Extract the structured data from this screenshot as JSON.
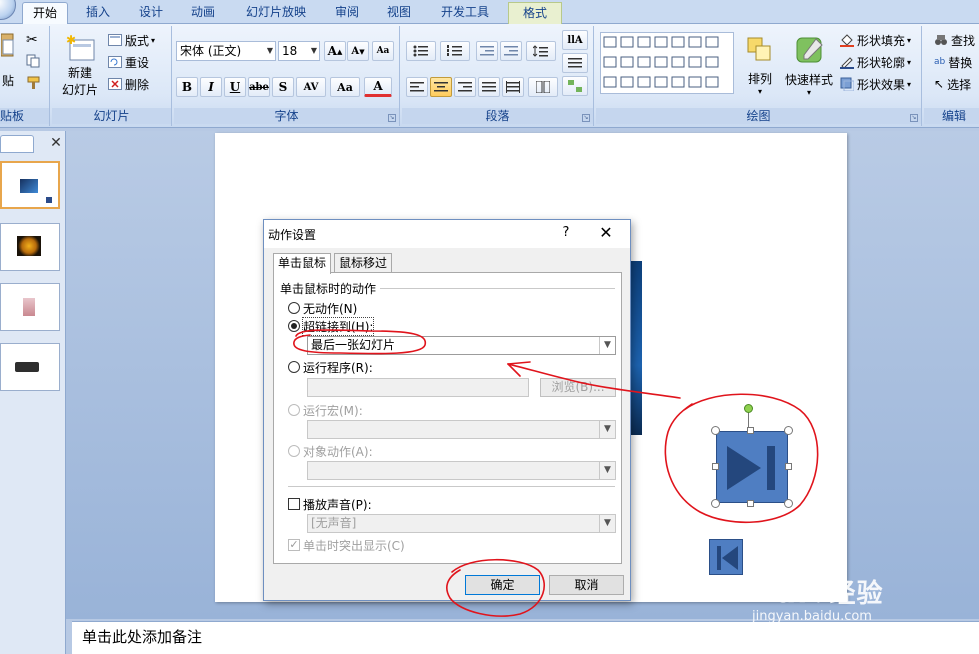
{
  "ribbon_tabs": [
    "开始",
    "插入",
    "设计",
    "动画",
    "幻灯片放映",
    "审阅",
    "视图",
    "开发工具",
    "格式"
  ],
  "clipboard": {
    "paste_label": "贴",
    "group_label": "贴板"
  },
  "slides_group": {
    "new_slide_line1": "新建",
    "new_slide_line2": "幻灯片",
    "layout_label": "版式",
    "reset_label": "重设",
    "delete_label": "删除",
    "group_label": "幻灯片"
  },
  "font_group": {
    "font_name": "宋体 (正文)",
    "font_size": "18",
    "bold": "B",
    "italic": "I",
    "underline": "U",
    "strike": "abe",
    "shadow": "S",
    "spacing": "AV",
    "case": "Aa",
    "color": "A",
    "group_label": "字体"
  },
  "paragraph_group": {
    "group_label": "段落"
  },
  "drawing_group": {
    "arrange_label": "排列",
    "quick_styles_label": "快速样式",
    "shape_fill_label": "形状填充",
    "shape_outline_label": "形状轮廓",
    "shape_effects_label": "形状效果",
    "group_label": "绘图"
  },
  "editing_group": {
    "find_label": "查找",
    "replace_label": "替换",
    "select_label": "选择",
    "group_label": "编辑"
  },
  "notes_placeholder": "单击此处添加备注",
  "dialog": {
    "title": "动作设置",
    "help": "?",
    "close": "✕",
    "tabs": [
      "单击鼠标",
      "鼠标移过"
    ],
    "section_title": "单击鼠标时的动作",
    "options": {
      "none": "无动作(N)",
      "hyperlink": "超链接到(H):",
      "hyperlink_value": "最后一张幻灯片",
      "run_program": "运行程序(R):",
      "browse": "浏览(B)...",
      "run_macro": "运行宏(M):",
      "object_action": "对象动作(A):",
      "play_sound": "播放声音(P):",
      "sound_value": "[无声音]",
      "highlight": "单击时突出显示(C)"
    },
    "ok": "确定",
    "cancel": "取消"
  },
  "watermark": {
    "brand": "Bai",
    "brand2": "经验",
    "url": "jingyan.baidu.com"
  }
}
